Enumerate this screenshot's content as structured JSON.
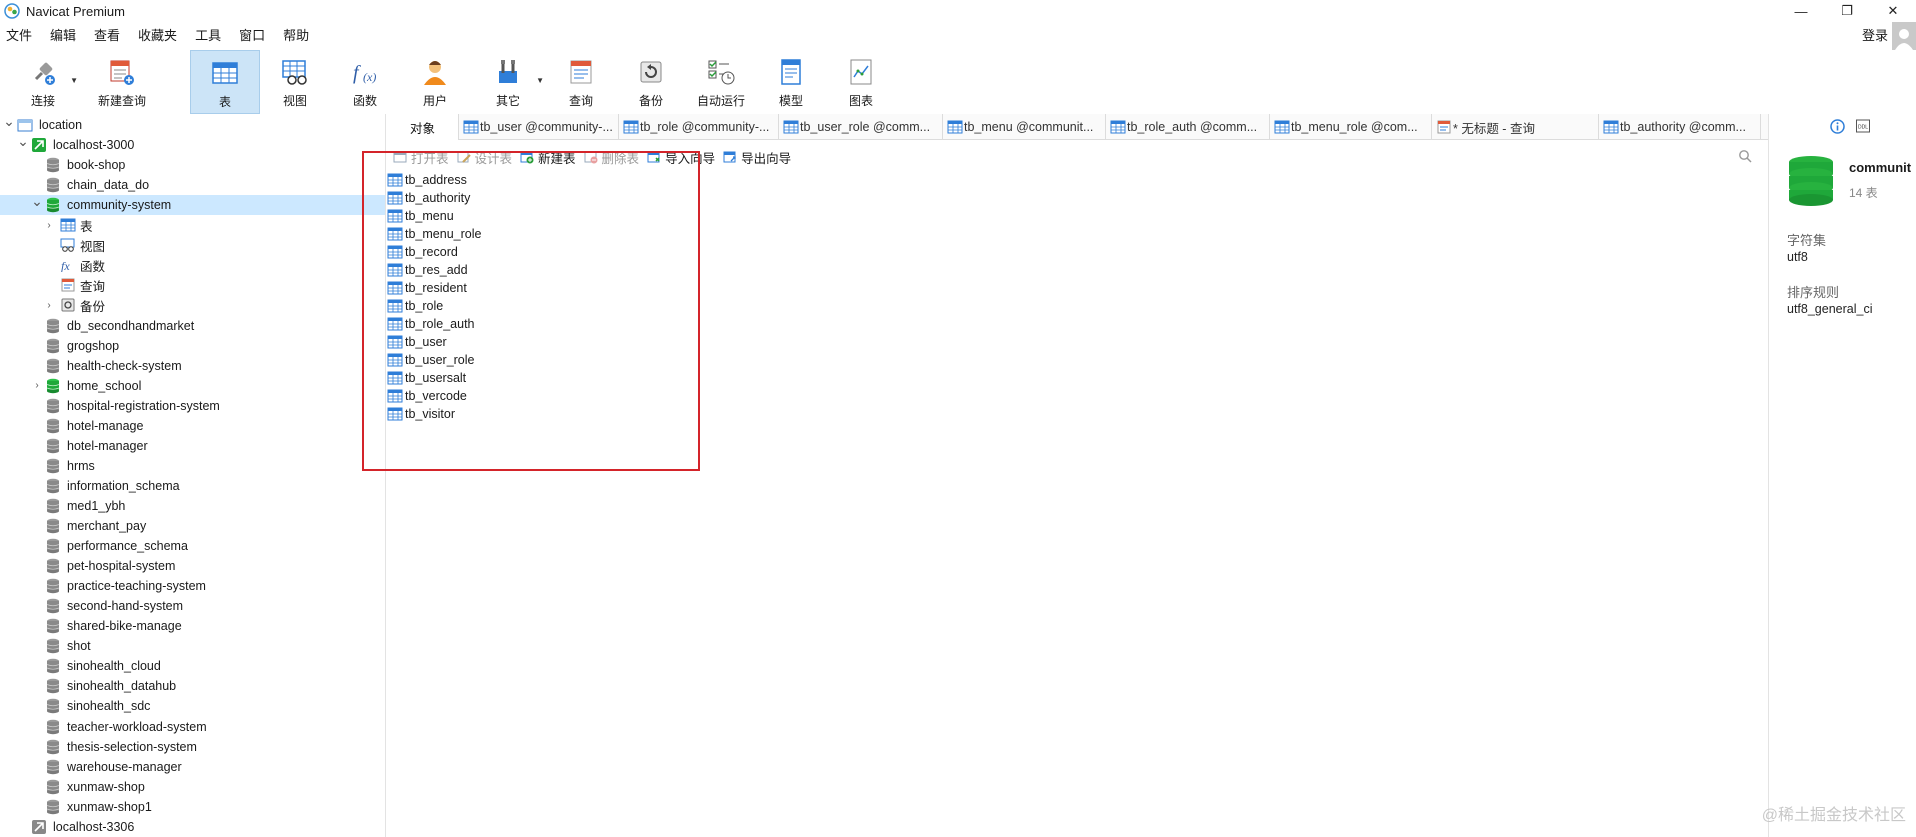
{
  "window": {
    "title": "Navicat Premium",
    "min": "—",
    "restore": "❐",
    "close": "✕"
  },
  "menu": {
    "items": [
      "文件",
      "编辑",
      "查看",
      "收藏夹",
      "工具",
      "窗口",
      "帮助"
    ],
    "login": "登录"
  },
  "toolbar": {
    "buttons": [
      {
        "label": "连接",
        "icon": "plug-icon",
        "dropdown": true
      },
      {
        "label": "新建查询",
        "icon": "new-query-icon",
        "dropdown": false
      },
      {
        "label": "表",
        "icon": "table-icon",
        "dropdown": false,
        "active": true
      },
      {
        "label": "视图",
        "icon": "view-icon",
        "dropdown": false
      },
      {
        "label": "函数",
        "icon": "function-icon",
        "dropdown": false
      },
      {
        "label": "用户",
        "icon": "user-icon",
        "dropdown": false
      },
      {
        "label": "其它",
        "icon": "tools-icon",
        "dropdown": true
      },
      {
        "label": "查询",
        "icon": "query-icon",
        "dropdown": false
      },
      {
        "label": "备份",
        "icon": "backup-icon",
        "dropdown": false
      },
      {
        "label": "自动运行",
        "icon": "schedule-icon",
        "dropdown": false
      },
      {
        "label": "模型",
        "icon": "model-icon",
        "dropdown": false
      },
      {
        "label": "图表",
        "icon": "chart-icon",
        "dropdown": false
      }
    ]
  },
  "tree": {
    "items": [
      {
        "label": "location",
        "level": 0,
        "arrow": "down",
        "icon": "folder"
      },
      {
        "label": "localhost-3000",
        "level": 1,
        "arrow": "down",
        "icon": "conn-green"
      },
      {
        "label": "book-shop",
        "level": 2,
        "icon": "db-gray"
      },
      {
        "label": "chain_data_do",
        "level": 2,
        "icon": "db-gray"
      },
      {
        "label": "community-system",
        "level": 2,
        "arrow": "down",
        "icon": "db-green",
        "selected": true
      },
      {
        "label": "表",
        "level": 3,
        "arrow": "right",
        "icon": "table"
      },
      {
        "label": "视图",
        "level": 3,
        "icon": "view"
      },
      {
        "label": "函数",
        "level": 3,
        "icon": "func"
      },
      {
        "label": "查询",
        "level": 3,
        "icon": "query"
      },
      {
        "label": "备份",
        "level": 3,
        "arrow": "right",
        "icon": "backup"
      },
      {
        "label": "db_secondhandmarket",
        "level": 2,
        "icon": "db-gray"
      },
      {
        "label": "grogshop",
        "level": 2,
        "icon": "db-gray"
      },
      {
        "label": "health-check-system",
        "level": 2,
        "icon": "db-gray"
      },
      {
        "label": "home_school",
        "level": 2,
        "arrow": "right",
        "icon": "db-green"
      },
      {
        "label": "hospital-registration-system",
        "level": 2,
        "icon": "db-gray"
      },
      {
        "label": "hotel-manage",
        "level": 2,
        "icon": "db-gray"
      },
      {
        "label": "hotel-manager",
        "level": 2,
        "icon": "db-gray"
      },
      {
        "label": "hrms",
        "level": 2,
        "icon": "db-gray"
      },
      {
        "label": "information_schema",
        "level": 2,
        "icon": "db-gray"
      },
      {
        "label": "med1_ybh",
        "level": 2,
        "icon": "db-gray"
      },
      {
        "label": "merchant_pay",
        "level": 2,
        "icon": "db-gray"
      },
      {
        "label": "performance_schema",
        "level": 2,
        "icon": "db-gray"
      },
      {
        "label": "pet-hospital-system",
        "level": 2,
        "icon": "db-gray"
      },
      {
        "label": "practice-teaching-system",
        "level": 2,
        "icon": "db-gray"
      },
      {
        "label": "second-hand-system",
        "level": 2,
        "icon": "db-gray"
      },
      {
        "label": "shared-bike-manage",
        "level": 2,
        "icon": "db-gray"
      },
      {
        "label": "shot",
        "level": 2,
        "icon": "db-gray"
      },
      {
        "label": "sinohealth_cloud",
        "level": 2,
        "icon": "db-gray"
      },
      {
        "label": "sinohealth_datahub",
        "level": 2,
        "icon": "db-gray"
      },
      {
        "label": "sinohealth_sdc",
        "level": 2,
        "icon": "db-gray"
      },
      {
        "label": "teacher-workload-system",
        "level": 2,
        "icon": "db-gray"
      },
      {
        "label": "thesis-selection-system",
        "level": 2,
        "icon": "db-gray"
      },
      {
        "label": "warehouse-manager",
        "level": 2,
        "icon": "db-gray"
      },
      {
        "label": "xunmaw-shop",
        "level": 2,
        "icon": "db-gray"
      },
      {
        "label": "xunmaw-shop1",
        "level": 2,
        "icon": "db-gray"
      },
      {
        "label": "localhost-3306",
        "level": 1,
        "icon": "conn-gray"
      }
    ]
  },
  "tabs": {
    "objects": "对象",
    "items": [
      {
        "label": "tb_user @community-...",
        "icon": "table"
      },
      {
        "label": "tb_role @community-...",
        "icon": "table"
      },
      {
        "label": "tb_user_role @comm...",
        "icon": "table"
      },
      {
        "label": "tb_menu @communit...",
        "icon": "table"
      },
      {
        "label": "tb_role_auth @comm...",
        "icon": "table"
      },
      {
        "label": "tb_menu_role @com...",
        "icon": "table"
      },
      {
        "label": "* 无标题 - 查询",
        "icon": "query"
      },
      {
        "label": "tb_authority @comm...",
        "icon": "table"
      }
    ]
  },
  "object_toolbar": {
    "open": "打开表",
    "design": "设计表",
    "new": "新建表",
    "delete": "删除表",
    "import": "导入向导",
    "export": "导出向导"
  },
  "tables": [
    "tb_address",
    "tb_authority",
    "tb_menu",
    "tb_menu_role",
    "tb_record",
    "tb_res_add",
    "tb_resident",
    "tb_role",
    "tb_role_auth",
    "tb_user",
    "tb_user_role",
    "tb_usersalt",
    "tb_vercode",
    "tb_visitor"
  ],
  "info": {
    "db_name": "communit",
    "table_count": "14 表",
    "charset_label": "字符集",
    "charset": "utf8",
    "collation_label": "排序规则",
    "collation": "utf8_general_ci",
    "ddl": "DDL"
  },
  "watermark": "@稀土掘金技术社区",
  "colors": {
    "accent": "#cce4f7",
    "selected_row": "#cce8ff",
    "highlight_border": "#d4242a",
    "db_green": "#1fa83a"
  }
}
